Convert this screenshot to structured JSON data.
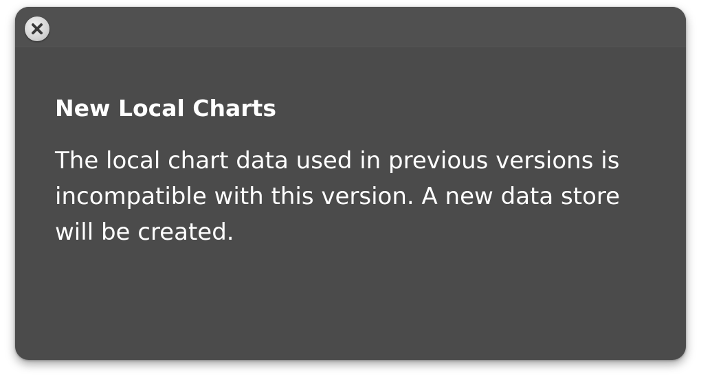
{
  "dialog": {
    "close_icon": "close-icon",
    "title": "New Local Charts",
    "message": "The local chart data used in previous versions is incompatible with this version. A new data store will be created."
  },
  "colors": {
    "panel_background": "#4b4b4b",
    "text": "#ffffff"
  }
}
